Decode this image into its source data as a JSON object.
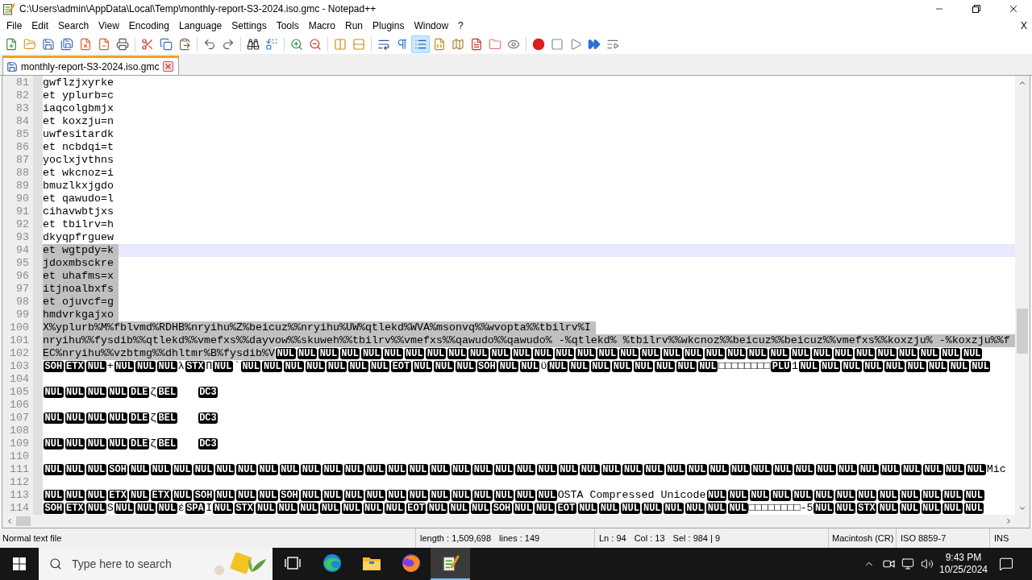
{
  "window": {
    "title": "C:\\Users\\admin\\AppData\\Local\\Temp\\monthly-report-S3-2024.iso.gmc - Notepad++"
  },
  "menu": {
    "items": [
      "File",
      "Edit",
      "Search",
      "View",
      "Encoding",
      "Language",
      "Settings",
      "Tools",
      "Macro",
      "Run",
      "Plugins",
      "Window",
      "?"
    ],
    "close_document": "X"
  },
  "toolbar": [
    {
      "buttons": [
        {
          "kind": "new",
          "pressed": false
        },
        {
          "kind": "open",
          "pressed": false
        },
        {
          "kind": "save",
          "pressed": false
        },
        {
          "kind": "save-all",
          "pressed": false
        },
        {
          "kind": "close",
          "pressed": false
        },
        {
          "kind": "close-all",
          "pressed": false
        },
        {
          "kind": "print",
          "pressed": false
        }
      ]
    },
    {
      "buttons": [
        {
          "kind": "cut",
          "pressed": false
        },
        {
          "kind": "copy",
          "pressed": false
        },
        {
          "kind": "paste",
          "pressed": false
        }
      ]
    },
    {
      "buttons": [
        {
          "kind": "undo",
          "pressed": false
        },
        {
          "kind": "redo",
          "pressed": false
        }
      ]
    },
    {
      "buttons": [
        {
          "kind": "find",
          "pressed": false
        },
        {
          "kind": "replace",
          "pressed": false
        }
      ]
    },
    {
      "buttons": [
        {
          "kind": "zoom-in",
          "pressed": false
        },
        {
          "kind": "zoom-out",
          "pressed": false
        }
      ]
    },
    {
      "buttons": [
        {
          "kind": "sync-vertical",
          "pressed": false
        },
        {
          "kind": "sync-horizontal",
          "pressed": false
        }
      ]
    },
    {
      "buttons": [
        {
          "kind": "word-wrap",
          "pressed": false
        },
        {
          "kind": "all-characters",
          "pressed": false
        },
        {
          "kind": "indent-guide",
          "pressed": true
        },
        {
          "kind": "user-language",
          "pressed": false
        },
        {
          "kind": "document-map",
          "pressed": false
        },
        {
          "kind": "function-list",
          "pressed": false
        },
        {
          "kind": "folder-workspace",
          "pressed": false
        },
        {
          "kind": "monitoring",
          "pressed": false
        }
      ]
    },
    {
      "buttons": [
        {
          "kind": "record",
          "pressed": false
        },
        {
          "kind": "stop",
          "pressed": false
        },
        {
          "kind": "play",
          "pressed": false
        },
        {
          "kind": "play-multiple",
          "pressed": false
        },
        {
          "kind": "save-macro",
          "pressed": false
        }
      ]
    }
  ],
  "tabs": [
    {
      "label": "monthly-report-S3-2024.iso.gmc",
      "selected": true
    }
  ],
  "editor": {
    "lines": [
      {
        "number": "81",
        "selected": false,
        "current": false,
        "segments": [
          {
            "kind": "text",
            "text": "gwflzjxyrke"
          }
        ]
      },
      {
        "number": "82",
        "selected": false,
        "current": false,
        "segments": [
          {
            "kind": "text",
            "text": "et yplurb=c"
          }
        ]
      },
      {
        "number": "83",
        "selected": false,
        "current": false,
        "segments": [
          {
            "kind": "text",
            "text": "iaqcolgbmjx"
          }
        ]
      },
      {
        "number": "84",
        "selected": false,
        "current": false,
        "segments": [
          {
            "kind": "text",
            "text": "et koxzju=n"
          }
        ]
      },
      {
        "number": "85",
        "selected": false,
        "current": false,
        "segments": [
          {
            "kind": "text",
            "text": "uwfesitardk"
          }
        ]
      },
      {
        "number": "86",
        "selected": false,
        "current": false,
        "segments": [
          {
            "kind": "text",
            "text": "et ncbdqi=t"
          }
        ]
      },
      {
        "number": "87",
        "selected": false,
        "current": false,
        "segments": [
          {
            "kind": "text",
            "text": "yoclxjvthns"
          }
        ]
      },
      {
        "number": "88",
        "selected": false,
        "current": false,
        "segments": [
          {
            "kind": "text",
            "text": "et wkcnoz=i"
          }
        ]
      },
      {
        "number": "89",
        "selected": false,
        "current": false,
        "segments": [
          {
            "kind": "text",
            "text": "bmuzlkxjgdo"
          }
        ]
      },
      {
        "number": "90",
        "selected": false,
        "current": false,
        "segments": [
          {
            "kind": "text",
            "text": "et qawudo=l"
          }
        ]
      },
      {
        "number": "91",
        "selected": false,
        "current": false,
        "segments": [
          {
            "kind": "text",
            "text": "cihavwbtjxs"
          }
        ]
      },
      {
        "number": "92",
        "selected": false,
        "current": false,
        "segments": [
          {
            "kind": "text",
            "text": "et tbilrv=h"
          }
        ]
      },
      {
        "number": "93",
        "selected": false,
        "current": false,
        "segments": [
          {
            "kind": "text",
            "text": "dkyqpfrguew"
          }
        ]
      },
      {
        "number": "94",
        "selected": true,
        "current": true,
        "segments": [
          {
            "kind": "text",
            "text": "et wgtpdy=k"
          }
        ]
      },
      {
        "number": "95",
        "selected": true,
        "current": false,
        "segments": [
          {
            "kind": "text",
            "text": "jdoxmbsckre"
          }
        ]
      },
      {
        "number": "96",
        "selected": true,
        "current": false,
        "segments": [
          {
            "kind": "text",
            "text": "et uhafms=x"
          }
        ]
      },
      {
        "number": "97",
        "selected": true,
        "current": false,
        "segments": [
          {
            "kind": "text",
            "text": "itjnoalbxfs"
          }
        ]
      },
      {
        "number": "98",
        "selected": true,
        "current": false,
        "segments": [
          {
            "kind": "text",
            "text": "et ojuvcf=g"
          }
        ]
      },
      {
        "number": "99",
        "selected": true,
        "current": false,
        "segments": [
          {
            "kind": "text",
            "text": "hmdvrkgajxo"
          }
        ]
      },
      {
        "number": "100",
        "selected": true,
        "current": false,
        "segments": [
          {
            "kind": "text",
            "text": "X%yplurb%M%fblvmd%RDHB%nryihu%Z%beicuz%%nryihu%UW%qtlekd%WVA%msonvq%%wvopta%%tbilrv%I"
          }
        ]
      },
      {
        "number": "101",
        "selected": true,
        "current": false,
        "segments": [
          {
            "kind": "text",
            "text": "nryihu%%fysdib%%qtlekd%%vmefxs%%dayvow%%skuweh%%tbilrv%%vmefxs%%qawudo%%qawudo% -%qtlekd% %tbilrv%%wkcnoz%%beicuz%%beicuz%%vmefxs%%koxzju% -%koxzju%%f"
          }
        ]
      },
      {
        "number": "102",
        "selected": true,
        "current": false,
        "segments": [
          {
            "kind": "text",
            "text": "EC%nryihu%%vzbtmg%%dhltmr%B%fysdib%V"
          },
          {
            "kind": "ctrl",
            "text": "NUL"
          },
          {
            "kind": "ctrl",
            "text": "NUL"
          },
          {
            "kind": "ctrl",
            "text": "NUL"
          },
          {
            "kind": "ctrl",
            "text": "NUL"
          },
          {
            "kind": "ctrl",
            "text": "NUL"
          },
          {
            "kind": "ctrl",
            "text": "NUL"
          },
          {
            "kind": "ctrl",
            "text": "NUL"
          },
          {
            "kind": "ctrl",
            "text": "NUL"
          },
          {
            "kind": "ctrl",
            "text": "NUL"
          },
          {
            "kind": "ctrl",
            "text": "NUL"
          },
          {
            "kind": "ctrl",
            "text": "NUL"
          },
          {
            "kind": "ctrl",
            "text": "NUL"
          },
          {
            "kind": "ctrl",
            "text": "NUL"
          },
          {
            "kind": "ctrl",
            "text": "NUL"
          },
          {
            "kind": "ctrl",
            "text": "NUL"
          },
          {
            "kind": "ctrl",
            "text": "NUL"
          },
          {
            "kind": "ctrl",
            "text": "NUL"
          },
          {
            "kind": "ctrl",
            "text": "NUL"
          },
          {
            "kind": "ctrl",
            "text": "NUL"
          },
          {
            "kind": "ctrl",
            "text": "NUL"
          },
          {
            "kind": "ctrl",
            "text": "NUL"
          },
          {
            "kind": "ctrl",
            "text": "NUL"
          },
          {
            "kind": "ctrl",
            "text": "NUL"
          },
          {
            "kind": "ctrl",
            "text": "NUL"
          },
          {
            "kind": "ctrl",
            "text": "NUL"
          },
          {
            "kind": "ctrl",
            "text": "NUL"
          },
          {
            "kind": "ctrl",
            "text": "NUL"
          },
          {
            "kind": "ctrl",
            "text": "NUL"
          },
          {
            "kind": "ctrl",
            "text": "NUL"
          },
          {
            "kind": "ctrl",
            "text": "NUL"
          },
          {
            "kind": "ctrl",
            "text": "NUL"
          },
          {
            "kind": "ctrl",
            "text": "NUL"
          },
          {
            "kind": "ctrl",
            "text": "NUL"
          }
        ]
      },
      {
        "number": "103",
        "selected": false,
        "current": false,
        "segments": [
          {
            "kind": "ctrl",
            "text": "SOH"
          },
          {
            "kind": "ctrl",
            "text": "ETX"
          },
          {
            "kind": "ctrl",
            "text": "NUL"
          },
          {
            "kind": "text",
            "text": "+"
          },
          {
            "kind": "ctrl",
            "text": "NUL"
          },
          {
            "kind": "ctrl",
            "text": "NUL"
          },
          {
            "kind": "ctrl",
            "text": "NUL"
          },
          {
            "kind": "text",
            "text": "λ"
          },
          {
            "kind": "ctrl",
            "text": "STX"
          },
          {
            "kind": "text",
            "text": "Π"
          },
          {
            "kind": "ctrl",
            "text": "NUL"
          },
          {
            "kind": "text",
            "text": "`"
          },
          {
            "kind": "ctrl",
            "text": "NUL"
          },
          {
            "kind": "ctrl",
            "text": "NUL"
          },
          {
            "kind": "ctrl",
            "text": "NUL"
          },
          {
            "kind": "ctrl",
            "text": "NUL"
          },
          {
            "kind": "ctrl",
            "text": "NUL"
          },
          {
            "kind": "ctrl",
            "text": "NUL"
          },
          {
            "kind": "ctrl",
            "text": "NUL"
          },
          {
            "kind": "ctrl",
            "text": "EOT"
          },
          {
            "kind": "ctrl",
            "text": "NUL"
          },
          {
            "kind": "ctrl",
            "text": "NUL"
          },
          {
            "kind": "ctrl",
            "text": "NUL"
          },
          {
            "kind": "ctrl",
            "text": "SOH"
          },
          {
            "kind": "ctrl",
            "text": "NUL"
          },
          {
            "kind": "ctrl",
            "text": "NUL"
          },
          {
            "kind": "text",
            "text": "ϋ"
          },
          {
            "kind": "ctrl",
            "text": "NUL"
          },
          {
            "kind": "ctrl",
            "text": "NUL"
          },
          {
            "kind": "ctrl",
            "text": "NUL"
          },
          {
            "kind": "ctrl",
            "text": "NUL"
          },
          {
            "kind": "ctrl",
            "text": "NUL"
          },
          {
            "kind": "ctrl",
            "text": "NUL"
          },
          {
            "kind": "ctrl",
            "text": "NUL"
          },
          {
            "kind": "ctrl",
            "text": "NUL"
          },
          {
            "kind": "text",
            "text": "□□□□□□□□"
          },
          {
            "kind": "ctrl",
            "text": "PLU"
          },
          {
            "kind": "text",
            "text": "1"
          },
          {
            "kind": "ctrl",
            "text": "NUL"
          },
          {
            "kind": "ctrl",
            "text": "NUL"
          },
          {
            "kind": "ctrl",
            "text": "NUL"
          },
          {
            "kind": "ctrl",
            "text": "NUL"
          },
          {
            "kind": "ctrl",
            "text": "NUL"
          },
          {
            "kind": "ctrl",
            "text": "NUL"
          },
          {
            "kind": "ctrl",
            "text": "NUL"
          },
          {
            "kind": "ctrl",
            "text": "NUL"
          },
          {
            "kind": "ctrl",
            "text": "NUL"
          }
        ]
      },
      {
        "number": "104",
        "selected": false,
        "current": false
      },
      {
        "number": "105",
        "selected": false,
        "current": false,
        "segments": [
          {
            "kind": "ctrl",
            "text": "NUL"
          },
          {
            "kind": "ctrl",
            "text": "NUL"
          },
          {
            "kind": "ctrl",
            "text": "NUL"
          },
          {
            "kind": "ctrl",
            "text": "NUL"
          },
          {
            "kind": "ctrl",
            "text": "DLE"
          },
          {
            "kind": "text",
            "text": "ζ"
          },
          {
            "kind": "ctrl",
            "text": "BEL"
          },
          {
            "kind": "tab"
          },
          {
            "kind": "ctrl",
            "text": "DC3"
          }
        ]
      },
      {
        "number": "106",
        "selected": false,
        "current": false
      },
      {
        "number": "107",
        "selected": false,
        "current": false,
        "segments": [
          {
            "kind": "ctrl",
            "text": "NUL"
          },
          {
            "kind": "ctrl",
            "text": "NUL"
          },
          {
            "kind": "ctrl",
            "text": "NUL"
          },
          {
            "kind": "ctrl",
            "text": "NUL"
          },
          {
            "kind": "ctrl",
            "text": "DLE"
          },
          {
            "kind": "text",
            "text": "ζ"
          },
          {
            "kind": "ctrl",
            "text": "BEL"
          },
          {
            "kind": "tab"
          },
          {
            "kind": "ctrl",
            "text": "DC3"
          }
        ]
      },
      {
        "number": "108",
        "selected": false,
        "current": false
      },
      {
        "number": "109",
        "selected": false,
        "current": false,
        "segments": [
          {
            "kind": "ctrl",
            "text": "NUL"
          },
          {
            "kind": "ctrl",
            "text": "NUL"
          },
          {
            "kind": "ctrl",
            "text": "NUL"
          },
          {
            "kind": "ctrl",
            "text": "NUL"
          },
          {
            "kind": "ctrl",
            "text": "DLE"
          },
          {
            "kind": "text",
            "text": "ζ"
          },
          {
            "kind": "ctrl",
            "text": "BEL"
          },
          {
            "kind": "tab"
          },
          {
            "kind": "ctrl",
            "text": "DC3"
          }
        ]
      },
      {
        "number": "110",
        "selected": false,
        "current": false
      },
      {
        "number": "111",
        "selected": false,
        "current": false,
        "segments": [
          {
            "kind": "ctrl",
            "text": "NUL"
          },
          {
            "kind": "ctrl",
            "text": "NUL"
          },
          {
            "kind": "ctrl",
            "text": "NUL"
          },
          {
            "kind": "ctrl",
            "text": "SOH"
          },
          {
            "kind": "ctrl",
            "text": "NUL"
          },
          {
            "kind": "ctrl",
            "text": "NUL"
          },
          {
            "kind": "ctrl",
            "text": "NUL"
          },
          {
            "kind": "ctrl",
            "text": "NUL"
          },
          {
            "kind": "ctrl",
            "text": "NUL"
          },
          {
            "kind": "ctrl",
            "text": "NUL"
          },
          {
            "kind": "ctrl",
            "text": "NUL"
          },
          {
            "kind": "ctrl",
            "text": "NUL"
          },
          {
            "kind": "ctrl",
            "text": "NUL"
          },
          {
            "kind": "ctrl",
            "text": "NUL"
          },
          {
            "kind": "ctrl",
            "text": "NUL"
          },
          {
            "kind": "ctrl",
            "text": "NUL"
          },
          {
            "kind": "ctrl",
            "text": "NUL"
          },
          {
            "kind": "ctrl",
            "text": "NUL"
          },
          {
            "kind": "ctrl",
            "text": "NUL"
          },
          {
            "kind": "ctrl",
            "text": "NUL"
          },
          {
            "kind": "ctrl",
            "text": "NUL"
          },
          {
            "kind": "ctrl",
            "text": "NUL"
          },
          {
            "kind": "ctrl",
            "text": "NUL"
          },
          {
            "kind": "ctrl",
            "text": "NUL"
          },
          {
            "kind": "ctrl",
            "text": "NUL"
          },
          {
            "kind": "ctrl",
            "text": "NUL"
          },
          {
            "kind": "ctrl",
            "text": "NUL"
          },
          {
            "kind": "ctrl",
            "text": "NUL"
          },
          {
            "kind": "ctrl",
            "text": "NUL"
          },
          {
            "kind": "ctrl",
            "text": "NUL"
          },
          {
            "kind": "ctrl",
            "text": "NUL"
          },
          {
            "kind": "ctrl",
            "text": "NUL"
          },
          {
            "kind": "ctrl",
            "text": "NUL"
          },
          {
            "kind": "ctrl",
            "text": "NUL"
          },
          {
            "kind": "ctrl",
            "text": "NUL"
          },
          {
            "kind": "ctrl",
            "text": "NUL"
          },
          {
            "kind": "ctrl",
            "text": "NUL"
          },
          {
            "kind": "ctrl",
            "text": "NUL"
          },
          {
            "kind": "ctrl",
            "text": "NUL"
          },
          {
            "kind": "ctrl",
            "text": "NUL"
          },
          {
            "kind": "ctrl",
            "text": "NUL"
          },
          {
            "kind": "ctrl",
            "text": "NUL"
          },
          {
            "kind": "ctrl",
            "text": "NUL"
          },
          {
            "kind": "ctrl",
            "text": "NUL"
          },
          {
            "kind": "text",
            "text": "Mic"
          }
        ]
      },
      {
        "number": "112",
        "selected": false,
        "current": false
      },
      {
        "number": "113",
        "selected": false,
        "current": false,
        "segments": [
          {
            "kind": "ctrl",
            "text": "NUL"
          },
          {
            "kind": "ctrl",
            "text": "NUL"
          },
          {
            "kind": "ctrl",
            "text": "NUL"
          },
          {
            "kind": "ctrl",
            "text": "ETX"
          },
          {
            "kind": "ctrl",
            "text": "NUL"
          },
          {
            "kind": "ctrl",
            "text": "ETX"
          },
          {
            "kind": "ctrl",
            "text": "NUL"
          },
          {
            "kind": "ctrl",
            "text": "SOH"
          },
          {
            "kind": "ctrl",
            "text": "NUL"
          },
          {
            "kind": "ctrl",
            "text": "NUL"
          },
          {
            "kind": "ctrl",
            "text": "NUL"
          },
          {
            "kind": "ctrl",
            "text": "SOH"
          },
          {
            "kind": "ctrl",
            "text": "NUL"
          },
          {
            "kind": "ctrl",
            "text": "NUL"
          },
          {
            "kind": "ctrl",
            "text": "NUL"
          },
          {
            "kind": "ctrl",
            "text": "NUL"
          },
          {
            "kind": "ctrl",
            "text": "NUL"
          },
          {
            "kind": "ctrl",
            "text": "NUL"
          },
          {
            "kind": "ctrl",
            "text": "NUL"
          },
          {
            "kind": "ctrl",
            "text": "NUL"
          },
          {
            "kind": "ctrl",
            "text": "NUL"
          },
          {
            "kind": "ctrl",
            "text": "NUL"
          },
          {
            "kind": "ctrl",
            "text": "NUL"
          },
          {
            "kind": "ctrl",
            "text": "NUL"
          },
          {
            "kind": "text",
            "text": "OSTA Compressed Unicode"
          },
          {
            "kind": "ctrl",
            "text": "NUL"
          },
          {
            "kind": "ctrl",
            "text": "NUL"
          },
          {
            "kind": "ctrl",
            "text": "NUL"
          },
          {
            "kind": "ctrl",
            "text": "NUL"
          },
          {
            "kind": "ctrl",
            "text": "NUL"
          },
          {
            "kind": "ctrl",
            "text": "NUL"
          },
          {
            "kind": "ctrl",
            "text": "NUL"
          },
          {
            "kind": "ctrl",
            "text": "NUL"
          },
          {
            "kind": "ctrl",
            "text": "NUL"
          },
          {
            "kind": "ctrl",
            "text": "NUL"
          },
          {
            "kind": "ctrl",
            "text": "NUL"
          },
          {
            "kind": "ctrl",
            "text": "NUL"
          },
          {
            "kind": "ctrl",
            "text": "NUL"
          }
        ]
      },
      {
        "number": "114",
        "selected": false,
        "current": false,
        "segments": [
          {
            "kind": "ctrl",
            "text": "SOH"
          },
          {
            "kind": "ctrl",
            "text": "ETX"
          },
          {
            "kind": "ctrl",
            "text": "NUL"
          },
          {
            "kind": "text",
            "text": "S"
          },
          {
            "kind": "ctrl",
            "text": "NUL"
          },
          {
            "kind": "ctrl",
            "text": "NUL"
          },
          {
            "kind": "ctrl",
            "text": "NUL"
          },
          {
            "kind": "text",
            "text": "έ"
          },
          {
            "kind": "ctrl",
            "text": "SPA"
          },
          {
            "kind": "text",
            "text": "I"
          },
          {
            "kind": "ctrl",
            "text": "NUL"
          },
          {
            "kind": "ctrl",
            "text": "STX"
          },
          {
            "kind": "ctrl",
            "text": "NUL"
          },
          {
            "kind": "ctrl",
            "text": "NUL"
          },
          {
            "kind": "ctrl",
            "text": "NUL"
          },
          {
            "kind": "ctrl",
            "text": "NUL"
          },
          {
            "kind": "ctrl",
            "text": "NUL"
          },
          {
            "kind": "ctrl",
            "text": "NUL"
          },
          {
            "kind": "ctrl",
            "text": "NUL"
          },
          {
            "kind": "ctrl",
            "text": "EOT"
          },
          {
            "kind": "ctrl",
            "text": "NUL"
          },
          {
            "kind": "ctrl",
            "text": "NUL"
          },
          {
            "kind": "ctrl",
            "text": "NUL"
          },
          {
            "kind": "ctrl",
            "text": "SOH"
          },
          {
            "kind": "ctrl",
            "text": "NUL"
          },
          {
            "kind": "ctrl",
            "text": "NUL"
          },
          {
            "kind": "ctrl",
            "text": "EOT"
          },
          {
            "kind": "ctrl",
            "text": "NUL"
          },
          {
            "kind": "ctrl",
            "text": "NUL"
          },
          {
            "kind": "ctrl",
            "text": "NUL"
          },
          {
            "kind": "ctrl",
            "text": "NUL"
          },
          {
            "kind": "ctrl",
            "text": "NUL"
          },
          {
            "kind": "ctrl",
            "text": "NUL"
          },
          {
            "kind": "ctrl",
            "text": "NUL"
          },
          {
            "kind": "ctrl",
            "text": "NUL"
          },
          {
            "kind": "text",
            "text": "□□□□□□□□-5"
          },
          {
            "kind": "ctrl",
            "text": "NUL"
          },
          {
            "kind": "ctrl",
            "text": "NUL"
          },
          {
            "kind": "ctrl",
            "text": "STX"
          },
          {
            "kind": "ctrl",
            "text": "NUL"
          },
          {
            "kind": "ctrl",
            "text": "NUL"
          },
          {
            "kind": "ctrl",
            "text": "NUL"
          },
          {
            "kind": "ctrl",
            "text": "NUL"
          },
          {
            "kind": "ctrl",
            "text": "NUL"
          }
        ]
      }
    ]
  },
  "status_bar": {
    "document_type": "Normal text file",
    "length": "length : 1,509,698",
    "lines": "lines : 149",
    "line": "Ln : 94",
    "column": "Col : 13",
    "selection": "Sel : 984 | 9",
    "eol": "Macintosh (CR)",
    "encoding": "ISO 8859-7",
    "mode": "INS"
  },
  "taskbar": {
    "search": {
      "placeholder": "Type here to search"
    },
    "apps": [
      {
        "kind": "task-view",
        "active": false
      },
      {
        "kind": "browser",
        "active": false
      },
      {
        "kind": "explorer",
        "active": false
      },
      {
        "kind": "firefox",
        "active": false
      },
      {
        "kind": "notepad",
        "active": true
      }
    ],
    "clock": {
      "time": "9:43 PM",
      "date": "10/25/2024"
    }
  }
}
